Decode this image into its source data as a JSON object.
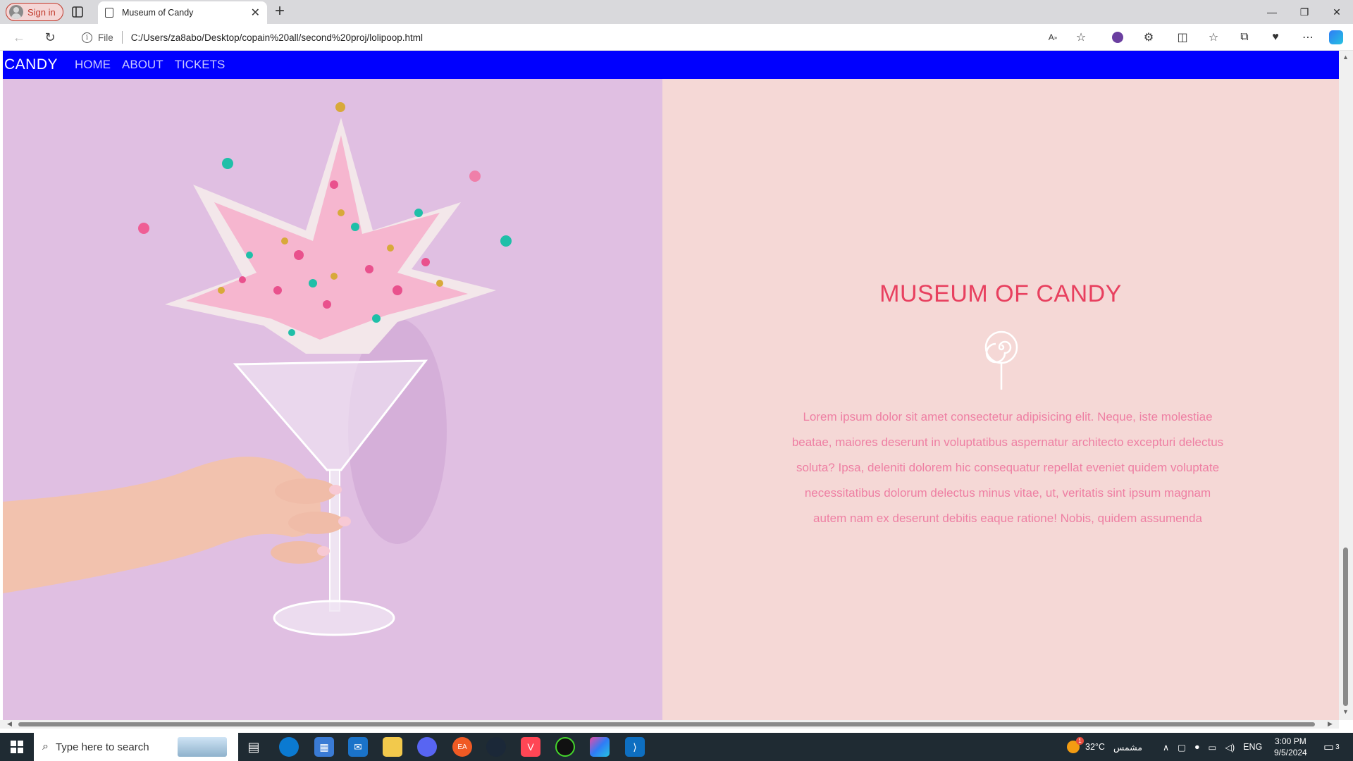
{
  "browser": {
    "signin_label": "Sign in",
    "tab_title": "Museum of Candy",
    "new_tab_symbol": "+",
    "file_label": "File",
    "url": "C:/Users/za8abo/Desktop/copain%20all/second%20proj/lolipoop.html",
    "window_controls": {
      "minimize": "—",
      "restore": "❐",
      "close": "✕"
    }
  },
  "site": {
    "brand": "CANDY",
    "nav": [
      "HOME",
      "ABOUT",
      "TICKETS"
    ],
    "hero": {
      "title": "MUSEUM OF CANDY",
      "body": "Lorem ipsum dolor sit amet consectetur adipisicing elit. Neque, iste molestiae beatae, maiores deserunt in voluptatibus aspernatur architecto excepturi delectus soluta? Ipsa, deleniti dolorem hic consequatur repellat eveniet quidem voluptate necessitatibus dolorum delectus minus vitae, ut, veritatis sint ipsum magnam autem nam ex deserunt debitis eaque ratione! Nobis, quidem assumenda"
    },
    "colors": {
      "navbar": "#0000ff",
      "left_bg": "#e0bfe2",
      "right_bg": "#f5d8d6",
      "title": "#e8405f",
      "body_text": "#ee7fa3"
    }
  },
  "taskbar": {
    "search_placeholder": "Type here to search",
    "weather": "32°C",
    "weather_desc": "مشمس",
    "language": "ENG",
    "time": "3:00 PM",
    "date": "9/5/2024",
    "notification_count": "3",
    "weather_badge": "1",
    "pinned_icons": [
      "task-view-icon",
      "edge-icon",
      "store-icon",
      "mail-icon",
      "file-explorer-icon",
      "discord-icon",
      "ea-icon",
      "steam-icon",
      "valorant-icon",
      "razer-icon",
      "copilot-icon",
      "vscode-icon"
    ]
  }
}
